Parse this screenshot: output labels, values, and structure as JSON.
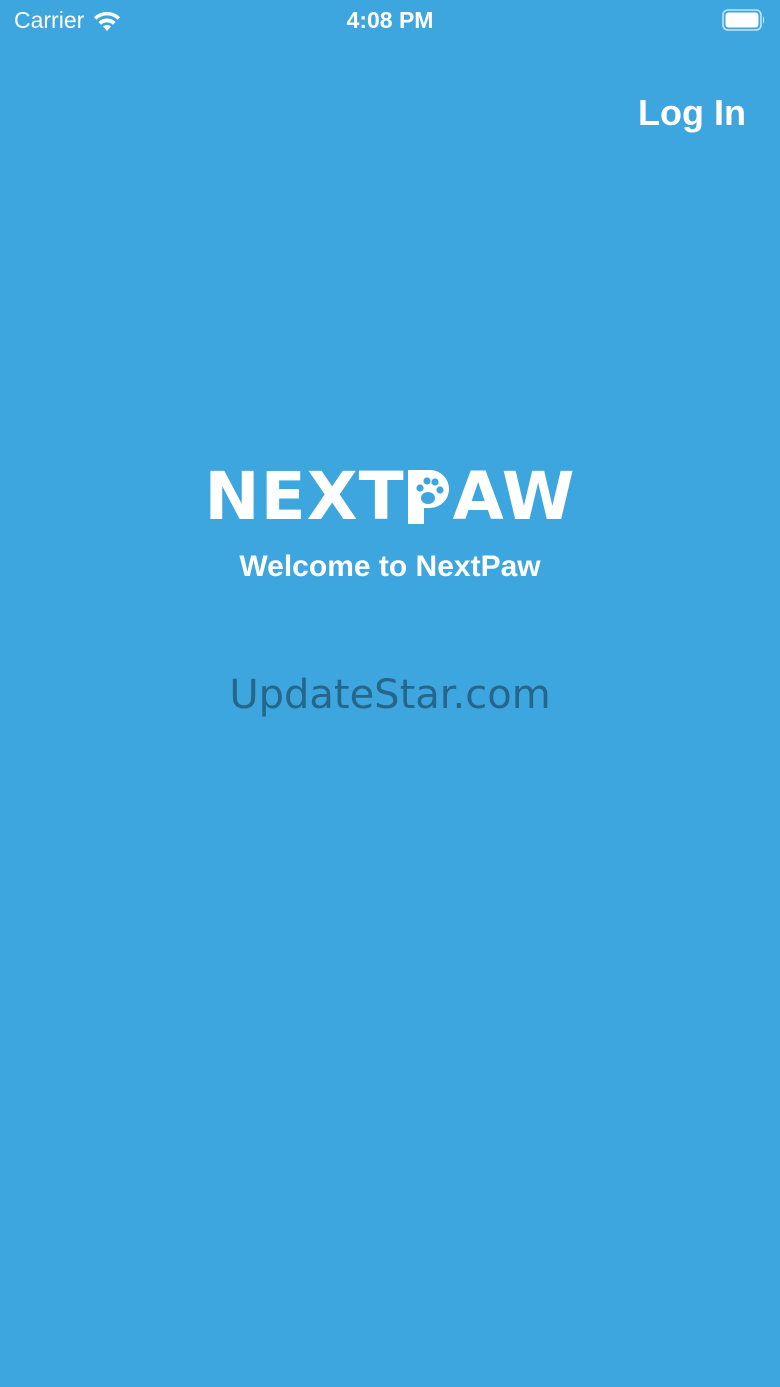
{
  "status_bar": {
    "carrier": "Carrier",
    "time": "4:08 PM",
    "wifi_icon": "wifi-icon",
    "battery_icon": "battery-icon"
  },
  "header": {
    "login_label": "Log In"
  },
  "brand": {
    "logo_text_left": "NEXT",
    "logo_text_right": "AW",
    "logo_icon": "paw-p-icon",
    "welcome": "Welcome to NextPaw"
  },
  "watermark": {
    "text": "UpdateStar.com"
  },
  "colors": {
    "background": "#3ea6de",
    "text": "#ffffff"
  }
}
